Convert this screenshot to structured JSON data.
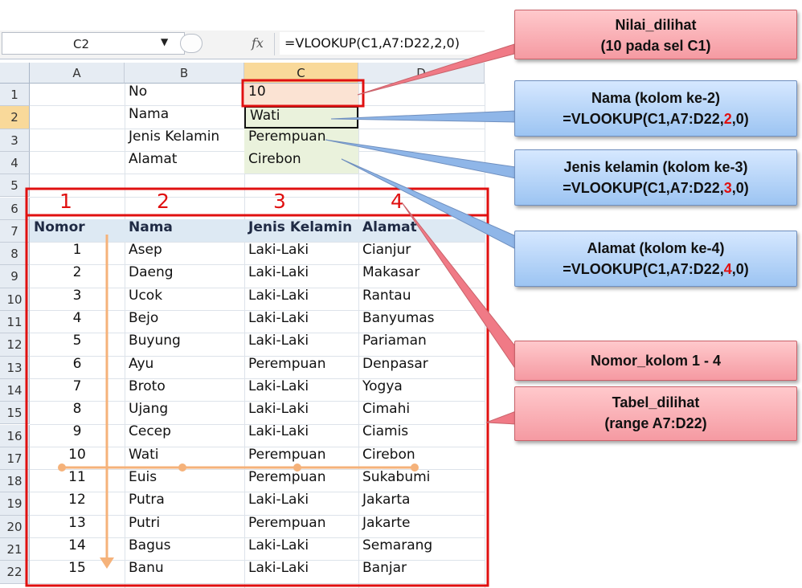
{
  "formula_bar": {
    "name_box": "C2",
    "fx_label": "fx",
    "formula": "=VLOOKUP(C1,A7:D22,2,0)"
  },
  "columns": [
    "A",
    "B",
    "C",
    "D"
  ],
  "rows": [
    "1",
    "2",
    "3",
    "4",
    "5",
    "6",
    "7",
    "8",
    "9",
    "10",
    "11",
    "12",
    "13",
    "14",
    "15",
    "16",
    "17",
    "18",
    "19",
    "20",
    "21",
    "22"
  ],
  "lookup": {
    "labels": [
      "No",
      "Nama",
      "Jenis Kelamin",
      "Alamat"
    ],
    "values": [
      "10",
      "Wati",
      "Perempuan",
      "Cirebon"
    ]
  },
  "column_numbers": [
    "1",
    "2",
    "3",
    "4"
  ],
  "table": {
    "headers": [
      "Nomor",
      "Nama",
      "Jenis Kelamin",
      "Alamat"
    ],
    "rows": [
      [
        "1",
        "Asep",
        "Laki-Laki",
        "Cianjur"
      ],
      [
        "2",
        "Daeng",
        "Laki-Laki",
        "Makasar"
      ],
      [
        "3",
        "Ucok",
        "Laki-Laki",
        "Rantau"
      ],
      [
        "4",
        "Bejo",
        "Laki-Laki",
        "Banyumas"
      ],
      [
        "5",
        "Buyung",
        "Laki-Laki",
        "Pariaman"
      ],
      [
        "6",
        "Ayu",
        "Perempuan",
        "Denpasar"
      ],
      [
        "7",
        "Broto",
        "Laki-Laki",
        "Yogya"
      ],
      [
        "8",
        "Ujang",
        "Laki-Laki",
        "Cimahi"
      ],
      [
        "9",
        "Cecep",
        "Laki-Laki",
        "Ciamis"
      ],
      [
        "10",
        "Wati",
        "Perempuan",
        "Cirebon"
      ],
      [
        "11",
        "Euis",
        "Perempuan",
        "Sukabumi"
      ],
      [
        "12",
        "Putra",
        "Laki-Laki",
        "Jakarta"
      ],
      [
        "13",
        "Putri",
        "Perempuan",
        "Jakarte"
      ],
      [
        "14",
        "Bagus",
        "Laki-Laki",
        "Semarang"
      ],
      [
        "15",
        "Banu",
        "Laki-Laki",
        "Banjar"
      ]
    ]
  },
  "callouts": {
    "nilai": {
      "line1": "Nilai_dilihat",
      "line2": "(10 pada sel C1)"
    },
    "nama": {
      "line1": "Nama (kolom ke-2)",
      "pre": "=VLOOKUP(C1,A7:D22,",
      "num": "2",
      "post": ",0)"
    },
    "jenis": {
      "line1": "Jenis kelamin (kolom ke-3)",
      "pre": "=VLOOKUP(C1,A7:D22,",
      "num": "3",
      "post": ",0)"
    },
    "alamat": {
      "line1": "Alamat (kolom ke-4)",
      "pre": "=VLOOKUP(C1,A7:D22,",
      "num": "4",
      "post": ",0)"
    },
    "nomor": {
      "line1": "Nomor_kolom  1 - 4"
    },
    "tabel": {
      "line1": "Tabel_dilihat",
      "line2": "(range A7:D22)"
    }
  },
  "colors": {
    "highlight_red": "#e01010",
    "selected_header": "#f9d99a",
    "lookup_value_bg": "#eaf2dc",
    "table_header_bg": "#dde9f3",
    "arrow_orange": "#f5b27a"
  }
}
